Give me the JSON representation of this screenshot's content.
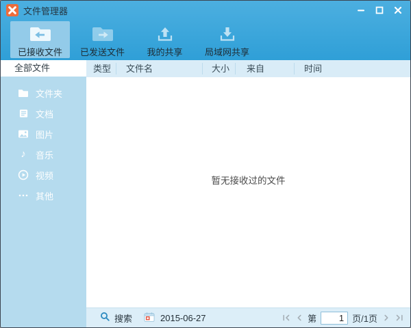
{
  "window": {
    "title": "文件管理器"
  },
  "colors": {
    "titlebar_blue": "#3FA8DD",
    "active_tab_highlight": "#93CBE9",
    "sidebar_blue": "#B5DBEE",
    "header_bar": "#D9ECF7",
    "status_bar": "#DCEEF8",
    "app_icon_orange": "#EE6C3A"
  },
  "toolbar": {
    "tabs": [
      {
        "label": "已接收文件",
        "icon": "folder-arrow-left",
        "active": true
      },
      {
        "label": "已发送文件",
        "icon": "folder-arrow-right",
        "active": false
      },
      {
        "label": "我的共享",
        "icon": "upload-tray",
        "active": false
      },
      {
        "label": "局域网共享",
        "icon": "download-tray",
        "active": false
      }
    ]
  },
  "sidebar": {
    "selected": "全部文件",
    "items": [
      {
        "label": "文件夹",
        "icon": "folder"
      },
      {
        "label": "文档",
        "icon": "document"
      },
      {
        "label": "图片",
        "icon": "picture"
      },
      {
        "label": "音乐",
        "icon": "music-note"
      },
      {
        "label": "视频",
        "icon": "video-play"
      },
      {
        "label": "其他",
        "icon": "ellipsis"
      }
    ]
  },
  "table": {
    "columns": [
      "类型",
      "文件名",
      "大小",
      "来自",
      "时间"
    ]
  },
  "main": {
    "empty_text": "暂无接收过的文件"
  },
  "statusbar": {
    "search_label": "搜索",
    "date": "2015-06-27",
    "pagination": {
      "prefix": "第",
      "page": "1",
      "suffix": "页/1页"
    }
  }
}
